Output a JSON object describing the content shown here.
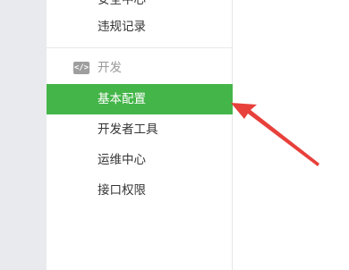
{
  "sidebar": {
    "partial_item_label": "安全中心",
    "violation_label": "违规记录",
    "section": {
      "label": "开发",
      "icon": "code-icon",
      "icon_glyph": "</>"
    },
    "items": [
      {
        "label": "基本配置",
        "active": true
      },
      {
        "label": "开发者工具",
        "active": false
      },
      {
        "label": "运维中心",
        "active": false
      },
      {
        "label": "接口权限",
        "active": false
      }
    ]
  },
  "colors": {
    "active_background": "#44b549",
    "arrow": "#e8403b",
    "gutter": "#e9eaee"
  }
}
